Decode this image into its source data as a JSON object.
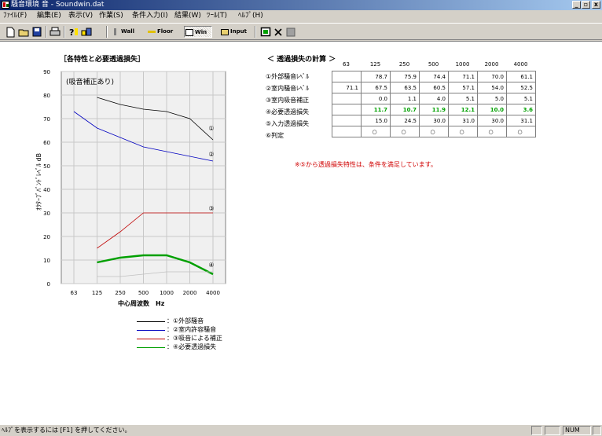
{
  "window": {
    "title": "騒音環境 音 - Soundwin.dat",
    "min_btn": "_",
    "max_btn": "▫",
    "close_btn": "x"
  },
  "menu": [
    "ﾌｧｲﾙ(F)",
    "編集(E)",
    "表示(V)",
    "作業(S)",
    "条件入力(I)",
    "結果(W)",
    "ﾂｰﾙ(T)",
    "ﾍﾙﾌﾟ(H)"
  ],
  "toolbar": {
    "wall": "Wall",
    "floor": "Floor",
    "win": "Win",
    "input": "Input"
  },
  "chart_panel": {
    "title": "［各特性と必要透過損失］",
    "badge": "(吸音補正あり)",
    "ylabel": "ｵｸﾀｰﾌﾞﾊﾞﾝﾄﾞﾚﾍﾞﾙ dB",
    "xlabel": "中心周波数　Hz",
    "curve_labels": [
      "①",
      "②",
      "③",
      "④"
    ]
  },
  "chart_data": {
    "type": "line",
    "x": [
      "63",
      "125",
      "250",
      "500",
      "1000",
      "2000",
      "4000"
    ],
    "yticks": [
      "0",
      "10",
      "20",
      "30",
      "40",
      "50",
      "60",
      "70",
      "80",
      "90"
    ],
    "ylim": [
      0,
      90
    ],
    "ylabel": "ｵｸﾀｰﾌﾞﾊﾞﾝﾄﾞﾚﾍﾞﾙ dB",
    "xlabel": "中心周波数　Hz",
    "grid": true,
    "series": [
      {
        "name": "①外部騒音",
        "color": "#000000",
        "values": [
          null,
          79,
          76,
          74,
          73,
          70,
          61
        ]
      },
      {
        "name": "②室内許容騒音",
        "color": "#0000c0",
        "values": [
          73,
          66,
          62,
          58,
          56,
          54,
          52
        ]
      },
      {
        "name": "③吸音による補正",
        "color": "#c00000",
        "values": [
          null,
          15,
          22,
          30,
          30,
          30,
          30
        ]
      },
      {
        "name": "④必要透過損失",
        "color": "#00a000",
        "values": [
          null,
          9,
          11,
          12,
          12,
          9,
          4
        ]
      },
      {
        "name": "",
        "color": "#c0c0c0",
        "values": [
          null,
          3,
          3,
          4,
          5,
          5,
          5
        ]
      }
    ]
  },
  "legend": [
    {
      "text": "：①外部騒音",
      "color": "#000000"
    },
    {
      "text": "：②室内許容騒音",
      "color": "#0000c0"
    },
    {
      "text": "：③吸音による補正",
      "color": "#c00000"
    },
    {
      "text": "：④必要透過損失",
      "color": "#00a000"
    }
  ],
  "results": {
    "title": "＜ 透過損失の計算 ＞",
    "columns": [
      "63",
      "125",
      "250",
      "500",
      "1000",
      "2000",
      "4000"
    ],
    "rows": [
      {
        "label": "①外部騒音ﾚﾍﾞﾙ",
        "values": [
          "",
          "78.7",
          "75.9",
          "74.4",
          "71.1",
          "70.0",
          "61.1"
        ],
        "green": false
      },
      {
        "label": "②室内騒音ﾚﾍﾞﾙ",
        "values": [
          "71.1",
          "67.5",
          "63.5",
          "60.5",
          "57.1",
          "54.0",
          "52.5"
        ],
        "green": false
      },
      {
        "label": "③室内吸音補正",
        "values": [
          "",
          "0.0",
          "1.1",
          "4.0",
          "5.1",
          "5.0",
          "5.1"
        ],
        "green": false
      },
      {
        "label": "④必要透過損失",
        "values": [
          "",
          "11.7",
          "10.7",
          "11.9",
          "12.1",
          "10.0",
          "3.6"
        ],
        "green": true
      },
      {
        "label": "⑤入力透過損失",
        "values": [
          "",
          "15.0",
          "24.5",
          "30.0",
          "31.0",
          "30.0",
          "31.1"
        ],
        "green": false
      },
      {
        "label": "⑥判定",
        "values": [
          "",
          "○",
          "○",
          "○",
          "○",
          "○",
          "○"
        ],
        "green": false
      }
    ],
    "note": "※⑤から透過損失特性は、条件を満足しています。"
  },
  "status": {
    "help": "ﾍﾙﾌﾟを表示するには [F1] を押してください。",
    "num": "NUM"
  }
}
